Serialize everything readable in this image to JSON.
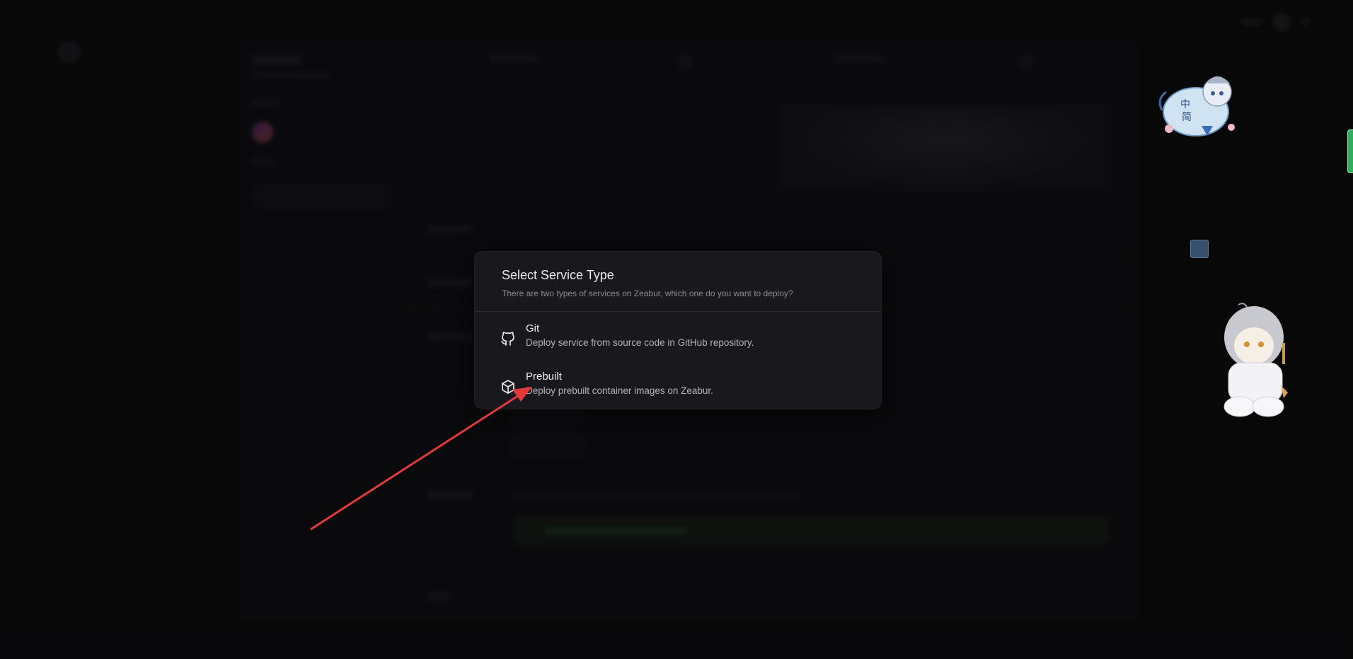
{
  "modal": {
    "title": "Select Service Type",
    "description": "There are two types of services on Zeabur, which one do you want to deploy?",
    "options": [
      {
        "title": "Git",
        "description": "Deploy service from source code in GitHub repository.",
        "icon": "github-icon"
      },
      {
        "title": "Prebuilt",
        "description": "Deploy prebuilt container images on Zeabur.",
        "icon": "box-icon"
      }
    ]
  },
  "annotation": {
    "arrow_color": "#e03a3a"
  },
  "decorations": {
    "mascot1_labels": [
      "中",
      "简"
    ]
  }
}
